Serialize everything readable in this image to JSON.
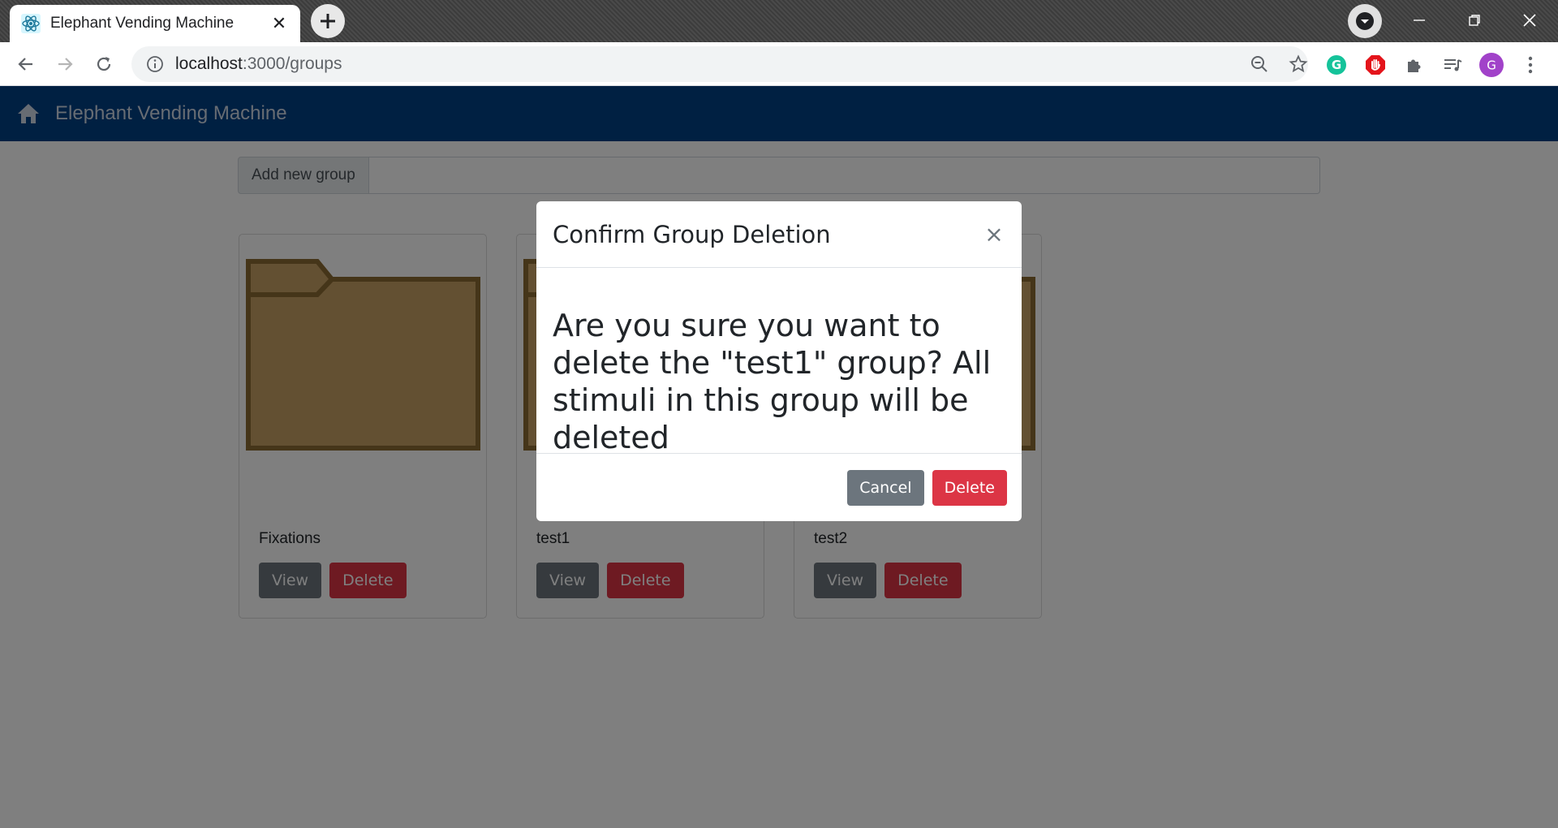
{
  "browser": {
    "tab_title": "Elephant Vending Machine",
    "url_host": "localhost",
    "url_rest": ":3000/groups",
    "profile_initial": "G"
  },
  "navbar": {
    "brand": "Elephant Vending Machine"
  },
  "page": {
    "add_group_label": "Add new group",
    "add_group_value": ""
  },
  "groups": [
    {
      "name": "Fixations",
      "view_label": "View",
      "delete_label": "Delete"
    },
    {
      "name": "test1",
      "view_label": "View",
      "delete_label": "Delete"
    },
    {
      "name": "test2",
      "view_label": "View",
      "delete_label": "Delete"
    }
  ],
  "modal": {
    "title": "Confirm Group Deletion",
    "close_glyph": "×",
    "message": "Are you sure you want to delete the \"test1\" group? All stimuli in this group will be deleted",
    "cancel_label": "Cancel",
    "delete_label": "Delete"
  },
  "colors": {
    "navbar": "#004085",
    "danger": "#dc3545",
    "secondary": "#6c757d",
    "folder_fill": "#c7a064",
    "folder_border": "#8b6a32"
  }
}
